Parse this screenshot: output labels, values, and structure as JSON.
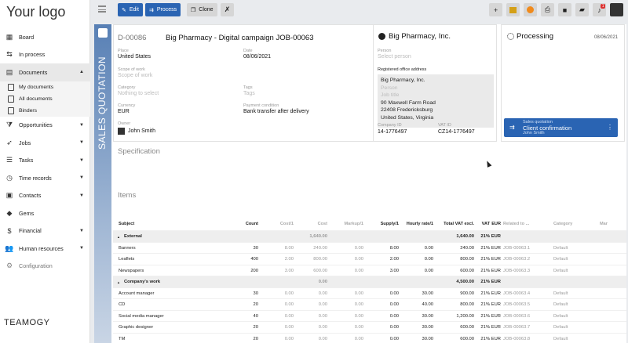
{
  "logo": "Your logo",
  "brand_footer": "TEAMOGY",
  "nav": {
    "items": [
      {
        "label": "Board",
        "icon": "grid-icon"
      },
      {
        "label": "In process",
        "icon": "flow-icon"
      },
      {
        "label": "Documents",
        "icon": "doc-icon"
      },
      {
        "label": "Opportunities",
        "icon": "filter-icon"
      },
      {
        "label": "Jobs",
        "icon": "rocket-icon"
      },
      {
        "label": "Tasks",
        "icon": "tasks-icon"
      },
      {
        "label": "Time records",
        "icon": "clock-icon"
      },
      {
        "label": "Contacts",
        "icon": "contacts-icon"
      },
      {
        "label": "Gems",
        "icon": "gem-icon"
      },
      {
        "label": "Financial",
        "icon": "dollar-icon"
      },
      {
        "label": "Human resources",
        "icon": "people-icon"
      },
      {
        "label": "Configuration",
        "icon": "gear-icon"
      }
    ],
    "documents_sub": [
      "My documents",
      "All documents",
      "Binders"
    ]
  },
  "toolbar": {
    "edit": "Edit",
    "process": "Process",
    "clone": "Clone",
    "badge": "1"
  },
  "doc": {
    "strip_label": "SALES QUOTATION",
    "number": "D-00086",
    "title": "Big Pharmacy - Digital campaign JOB-00063",
    "place_label": "Place",
    "place": "United States",
    "date_label": "Date",
    "date": "08/06/2021",
    "scope_label": "Scope of work",
    "scope": "Scope of work",
    "category_label": "Category",
    "category": "Nothing to select",
    "tags_label": "Tags",
    "tags": "Tags",
    "currency_label": "Currency",
    "currency": "EUR",
    "payment_label": "Payment condition",
    "payment": "Bank transfer after delivery",
    "owner_label": "Owner",
    "owner": "John Smith"
  },
  "client": {
    "name": "Big Pharmacy, Inc.",
    "person_label": "Person",
    "person": "Select person",
    "address_label": "Registered office address",
    "address_lines": [
      "Big Pharmacy, Inc.",
      "Person",
      "Job title",
      "90 Maxwell Farm Road",
      "22408 Fredericksburg",
      "United States, Virginia"
    ],
    "company_id_label": "Company ID",
    "company_id": "14-1776497",
    "vat_id_label": "VAT ID",
    "vat_id": "CZ14-1776497"
  },
  "process": {
    "title": "Processing",
    "date": "08/06/2021",
    "card_sub": "Sales quotation",
    "card_title": "Client confirmation",
    "card_owner": "John Smith"
  },
  "sections": {
    "specification": "Specification",
    "items": "Items"
  },
  "table": {
    "headers": [
      "Subject",
      "Count",
      "Cost/1",
      "Cost",
      "Markup/1",
      "Supply/1",
      "Hourly rate/1",
      "Total VAT excl.",
      "VAT",
      "EUR",
      "Related to ...",
      "Category",
      "Mar"
    ],
    "rows": [
      {
        "group": true,
        "subject": "External",
        "cost": "1,640.00",
        "total": "1,640.00",
        "vat": "21%",
        "cur": "EUR"
      },
      {
        "subject": "Banners",
        "count": "30",
        "cost1": "8.00",
        "cost": "240.00",
        "markup": "0.00",
        "supply": "8.00",
        "hourly": "0.00",
        "total": "240.00",
        "vat": "21%",
        "cur": "EUR",
        "rel": "JOB-00063.1",
        "cat": "Default"
      },
      {
        "subject": "Leaflets",
        "count": "400",
        "cost1": "2.00",
        "cost": "800.00",
        "markup": "0.00",
        "supply": "2.00",
        "hourly": "0.00",
        "total": "800.00",
        "vat": "21%",
        "cur": "EUR",
        "rel": "JOB-00063.2",
        "cat": "Default"
      },
      {
        "subject": "Newspapers",
        "count": "200",
        "cost1": "3.00",
        "cost": "600.00",
        "markup": "0.00",
        "supply": "3.00",
        "hourly": "0.00",
        "total": "600.00",
        "vat": "21%",
        "cur": "EUR",
        "rel": "JOB-00063.3",
        "cat": "Default"
      },
      {
        "group": true,
        "subject": "Company's work",
        "cost": "0.00",
        "total": "4,500.00",
        "vat": "21%",
        "cur": "EUR"
      },
      {
        "subject": "Account manager",
        "count": "30",
        "cost1": "0.00",
        "cost": "0.00",
        "markup": "0.00",
        "supply": "0.00",
        "hourly": "30.00",
        "total": "900.00",
        "vat": "21%",
        "cur": "EUR",
        "rel": "JOB-00063.4",
        "cat": "Default"
      },
      {
        "subject": "CD",
        "count": "20",
        "cost1": "0.00",
        "cost": "0.00",
        "markup": "0.00",
        "supply": "0.00",
        "hourly": "40.00",
        "total": "800.00",
        "vat": "21%",
        "cur": "EUR",
        "rel": "JOB-00063.5",
        "cat": "Default"
      },
      {
        "subject": "Social media manager",
        "count": "40",
        "cost1": "0.00",
        "cost": "0.00",
        "markup": "0.00",
        "supply": "0.00",
        "hourly": "30.00",
        "total": "1,200.00",
        "vat": "21%",
        "cur": "EUR",
        "rel": "JOB-00063.6",
        "cat": "Default"
      },
      {
        "subject": "Graphic designer",
        "count": "20",
        "cost1": "0.00",
        "cost": "0.00",
        "markup": "0.00",
        "supply": "0.00",
        "hourly": "30.00",
        "total": "600.00",
        "vat": "21%",
        "cur": "EUR",
        "rel": "JOB-00063.7",
        "cat": "Default"
      },
      {
        "subject": "TM",
        "count": "20",
        "cost1": "0.00",
        "cost": "0.00",
        "markup": "0.00",
        "supply": "0.00",
        "hourly": "30.00",
        "total": "600.00",
        "vat": "21%",
        "cur": "EUR",
        "rel": "JOB-00063.8",
        "cat": "Default"
      }
    ]
  },
  "colors": {
    "accent": "#2a64b3",
    "strip": "#5880b5"
  }
}
